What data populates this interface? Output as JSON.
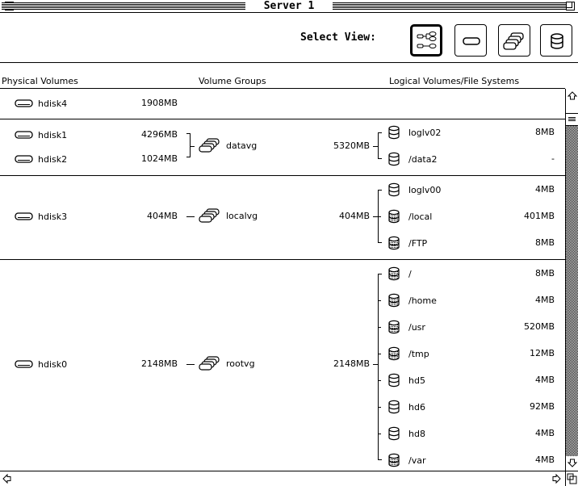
{
  "window": {
    "title": "Server 1"
  },
  "view_selector": {
    "label": "Select View:",
    "buttons": [
      {
        "name": "tree-view",
        "icon": "tree-view-icon",
        "selected": true
      },
      {
        "name": "physical-volume-view",
        "icon": "disk-icon",
        "selected": false
      },
      {
        "name": "volume-group-view",
        "icon": "volume-group-icon",
        "selected": false
      },
      {
        "name": "logical-volume-view",
        "icon": "cylinder-icon",
        "selected": false
      }
    ]
  },
  "columns": {
    "physical": "Physical Volumes",
    "groups": "Volume Groups",
    "logical": "Logical Volumes/File Systems"
  },
  "groups": [
    {
      "physical": [
        {
          "name": "hdisk4",
          "size": "1908MB"
        }
      ],
      "volume_group": null,
      "logical": []
    },
    {
      "physical": [
        {
          "name": "hdisk1",
          "size": "4296MB"
        },
        {
          "name": "hdisk2",
          "size": "1024MB"
        }
      ],
      "volume_group": {
        "name": "datavg",
        "size": "5320MB"
      },
      "logical": [
        {
          "name": "loglv02",
          "size": "8MB",
          "type": "plain"
        },
        {
          "name": "/data2",
          "size": "-",
          "type": "plain"
        }
      ]
    },
    {
      "physical": [
        {
          "name": "hdisk3",
          "size": "404MB"
        }
      ],
      "volume_group": {
        "name": "localvg",
        "size": "404MB"
      },
      "logical": [
        {
          "name": "loglv00",
          "size": "4MB",
          "type": "plain"
        },
        {
          "name": "/local",
          "size": "401MB",
          "type": "filesystem"
        },
        {
          "name": "/FTP",
          "size": "8MB",
          "type": "filesystem"
        }
      ]
    },
    {
      "physical": [
        {
          "name": "hdisk0",
          "size": "2148MB"
        }
      ],
      "volume_group": {
        "name": "rootvg",
        "size": "2148MB"
      },
      "logical": [
        {
          "name": "/",
          "size": "8MB",
          "type": "filesystem"
        },
        {
          "name": "/home",
          "size": "4MB",
          "type": "filesystem"
        },
        {
          "name": "/usr",
          "size": "520MB",
          "type": "filesystem"
        },
        {
          "name": "/tmp",
          "size": "12MB",
          "type": "filesystem"
        },
        {
          "name": "hd5",
          "size": "4MB",
          "type": "plain"
        },
        {
          "name": "hd6",
          "size": "92MB",
          "type": "plain"
        },
        {
          "name": "hd8",
          "size": "4MB",
          "type": "plain"
        },
        {
          "name": "/var",
          "size": "4MB",
          "type": "filesystem"
        }
      ]
    }
  ],
  "icons": {
    "disk": "disk-icon",
    "volume_group": "volume-group-icon",
    "logical_plain": "cylinder-icon",
    "logical_fs": "filesystem-cylinder-icon"
  }
}
